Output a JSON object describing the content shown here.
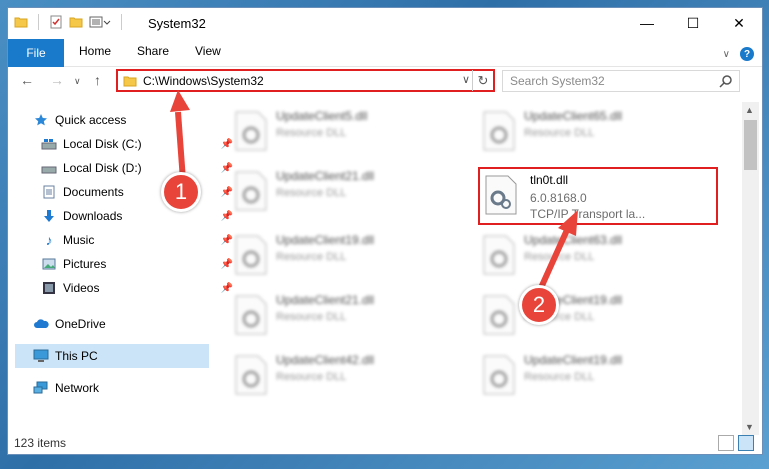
{
  "window": {
    "title": "System32"
  },
  "ribbon": {
    "tabs": [
      "File",
      "Home",
      "Share",
      "View"
    ]
  },
  "address": {
    "path": "C:\\Windows\\System32"
  },
  "search": {
    "placeholder": "Search System32"
  },
  "sidebar": {
    "items": [
      {
        "label": "Quick access",
        "icon": "star-icon"
      },
      {
        "label": "Local Disk (C:)",
        "icon": "drive-icon"
      },
      {
        "label": "Local Disk (D:)",
        "icon": "drive-icon"
      },
      {
        "label": "Documents",
        "icon": "document-icon"
      },
      {
        "label": "Downloads",
        "icon": "download-icon"
      },
      {
        "label": "Music",
        "icon": "music-icon"
      },
      {
        "label": "Pictures",
        "icon": "pictures-icon"
      },
      {
        "label": "Videos",
        "icon": "videos-icon"
      },
      {
        "label": "OneDrive",
        "icon": "cloud-icon"
      },
      {
        "label": "This PC",
        "icon": "computer-icon"
      },
      {
        "label": "Network",
        "icon": "network-icon"
      }
    ]
  },
  "files": [
    {
      "name": "UpdateClient5.dll",
      "type": "Resource DLL"
    },
    {
      "name": "UpdateClient65.dll",
      "type": "Resource DLL"
    },
    {
      "name": "UpdateClient21.dll",
      "type": "Resource DLL"
    },
    {
      "name": "tln0t.dll",
      "version": "6.0.8168.0",
      "description": "TCP/IP Transport la..."
    },
    {
      "name": "UpdateClient19.dll",
      "type": "Resource DLL"
    },
    {
      "name": "UpdateClient63.dll",
      "type": "Resource DLL"
    },
    {
      "name": "UpdateClient21.dll",
      "type": "Resource DLL"
    },
    {
      "name": "UpdateClient19.dll",
      "type": "Resource DLL"
    },
    {
      "name": "UpdateClient42.dll",
      "type": "Resource DLL"
    },
    {
      "name": "UpdateClient19.dll",
      "type": "Resource DLL"
    }
  ],
  "status": {
    "count": "123 items"
  },
  "annotations": {
    "step1": "1",
    "step2": "2"
  },
  "colors": {
    "accent": "#1979ca",
    "highlight": "#e02020",
    "badge": "#e8443a"
  }
}
